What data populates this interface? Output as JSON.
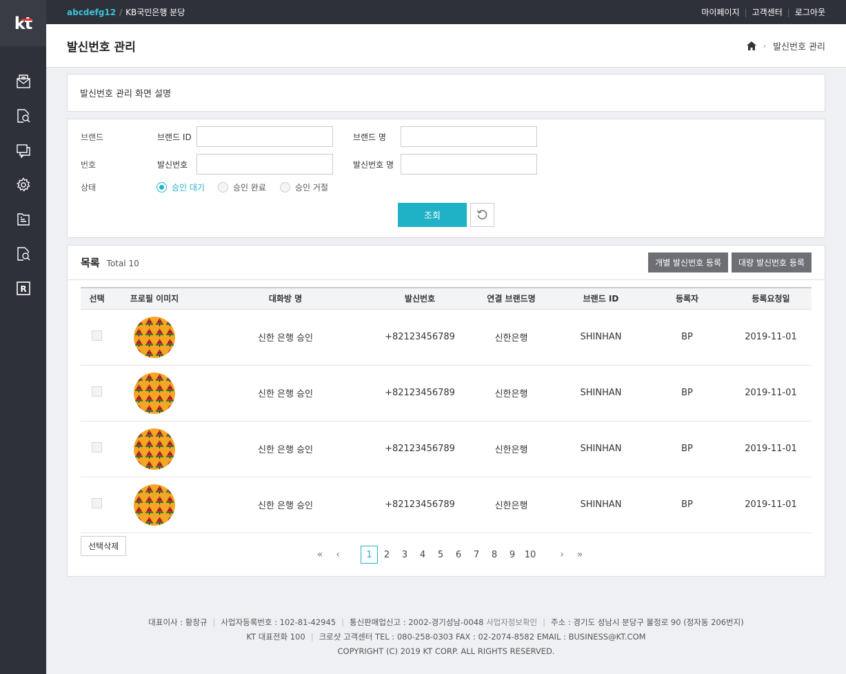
{
  "brand": {
    "logo_text": "kt",
    "accent": "#1fb2c7",
    "logo_bar": "#e5322d"
  },
  "topbar": {
    "user_id": "abcdefg12",
    "separator": "/",
    "org": "KB국민은행 분당",
    "links": [
      "마이페이지",
      "고객센터",
      "로그아웃"
    ]
  },
  "sidebar_icons": [
    "mail-icon",
    "search-doc-icon",
    "messages-icon",
    "gear-icon",
    "folder-icon",
    "search-doc-icon",
    "r-badge-icon"
  ],
  "page": {
    "title": "발신번호 관리",
    "breadcrumb": "발신번호 관리"
  },
  "description": "발신번호 관리 화면 설명",
  "filter": {
    "brand_label": "브랜드",
    "brand_id_label": "브랜드 ID",
    "brand_name_label": "브랜드 명",
    "number_label": "번호",
    "sender_number_label": "발신번호",
    "sender_name_label": "발신번호 명",
    "status_label": "상태",
    "status_options": [
      "승인 대기",
      "승인 완료",
      "승인 거절"
    ],
    "status_selected": "승인 대기",
    "search_button": "조회"
  },
  "list": {
    "title": "목록",
    "total": "Total 10",
    "btn_single": "개별 발신번호 등록",
    "btn_bulk": "대량 발신번호 등록",
    "columns": [
      "선택",
      "프로필 이미지",
      "대화방 명",
      "발신번호",
      "연결 브랜드명",
      "브랜드 ID",
      "등록자",
      "등록요청일"
    ],
    "rows": [
      {
        "room": "신한 은행 승인",
        "number": "+82123456789",
        "brand": "신한은행",
        "brand_id": "SHINHAN",
        "reg": "BP",
        "date": "2019-11-01"
      },
      {
        "room": "신한 은행 승인",
        "number": "+82123456789",
        "brand": "신한은행",
        "brand_id": "SHINHAN",
        "reg": "BP",
        "date": "2019-11-01"
      },
      {
        "room": "신한 은행 승인",
        "number": "+82123456789",
        "brand": "신한은행",
        "brand_id": "SHINHAN",
        "reg": "BP",
        "date": "2019-11-01"
      },
      {
        "room": "신한 은행 승인",
        "number": "+82123456789",
        "brand": "신한은행",
        "brand_id": "SHINHAN",
        "reg": "BP",
        "date": "2019-11-01"
      }
    ],
    "delete_button": "선택삭제"
  },
  "pagination": {
    "pages": [
      "1",
      "2",
      "3",
      "4",
      "5",
      "6",
      "7",
      "8",
      "9",
      "10"
    ],
    "current": "1"
  },
  "footer": {
    "ceo": "대표이사 : 황창규",
    "biz_no": "사업자등록번호 : 102-81-42945",
    "mail_order": "통신판매업신고 : 2002-경기성남-0048",
    "biz_info_link": "사업자정보확인",
    "address": "주소 : 경기도 성남시 분당구 불정로 90 (정자동 206번지)",
    "phone": "KT 대표전화 100",
    "center": "크로샷 고객센터 TEL : 080-258-0303 FAX : 02-2074-8582 EMAIL : BUSINESS@KT.COM",
    "copyright": "COPYRIGHT (C) 2019 KT CORP. ALL RIGHTS RESERVED."
  }
}
